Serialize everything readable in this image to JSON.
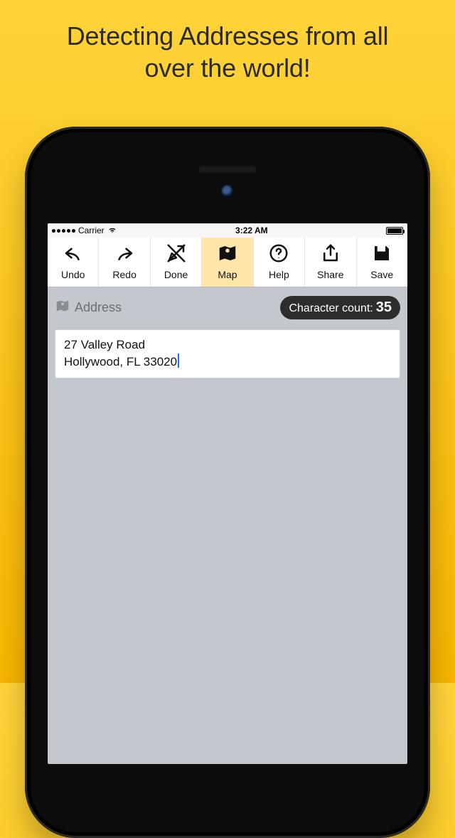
{
  "promo": {
    "headline_line1": "Detecting Addresses from all",
    "headline_line2": "over the world!"
  },
  "status_bar": {
    "carrier": "Carrier",
    "time": "3:22 AM"
  },
  "toolbar": {
    "items": [
      {
        "label": "Undo",
        "icon": "undo-icon",
        "active": false
      },
      {
        "label": "Redo",
        "icon": "redo-icon",
        "active": false
      },
      {
        "label": "Done",
        "icon": "done-icon",
        "active": false
      },
      {
        "label": "Map",
        "icon": "map-icon",
        "active": true
      },
      {
        "label": "Help",
        "icon": "help-icon",
        "active": false
      },
      {
        "label": "Share",
        "icon": "share-icon",
        "active": false
      },
      {
        "label": "Save",
        "icon": "save-icon",
        "active": false
      }
    ]
  },
  "section": {
    "label": "Address"
  },
  "char_counter": {
    "label": "Character count:",
    "value": "35"
  },
  "editor": {
    "line1": "27 Valley Road",
    "line2": "Hollywood, FL 33020"
  }
}
